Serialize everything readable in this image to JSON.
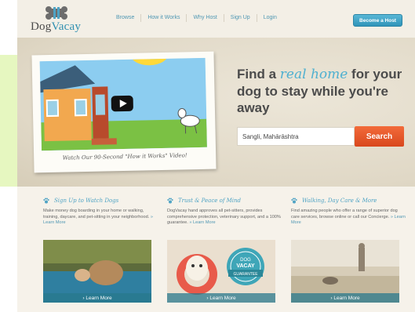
{
  "header": {
    "logo": {
      "part1": "Dog",
      "part2": "Vacay"
    },
    "nav": [
      "Browse",
      "How it Works",
      "Why Host",
      "Sign Up",
      "Login"
    ],
    "host_button": "Become a Host"
  },
  "hero": {
    "tagline": {
      "pre": "Find a ",
      "highlight": "real home",
      "post": " for your dog to stay while you're away"
    },
    "video_caption": "Watch Our 90-Second \"How it Works\" Video!",
    "search": {
      "value": "Sangli, Mahārāshtra",
      "button": "Search"
    }
  },
  "features": [
    {
      "title": "Sign Up to Watch Dogs",
      "text": "Make money dog boarding in your home or walking, training, daycare, and pet-sitting in your neighborhood.",
      "link": "» Learn More",
      "image_button": "› Learn More"
    },
    {
      "title": "Trust & Peace of Mind",
      "text": "DogVacay hand approves all pet-sitters, provides comprehensive protection, veterinary support, and a 100% guarantee.",
      "link": "» Learn More",
      "image_button": "› Learn More"
    },
    {
      "title": "Walking, Day Care & More",
      "text": "Find amazing people who offer a range of superior dog care services, browse online or call our Concierge.",
      "link": "» Learn More",
      "image_button": "› Learn More"
    }
  ],
  "badge": {
    "line1": "DOG",
    "line2": "VACAY",
    "line3": "GUARANTEE"
  },
  "colors": {
    "accent": "#4fa3c4",
    "search": "#e85a2b",
    "host_button": "#3aa3c8"
  }
}
